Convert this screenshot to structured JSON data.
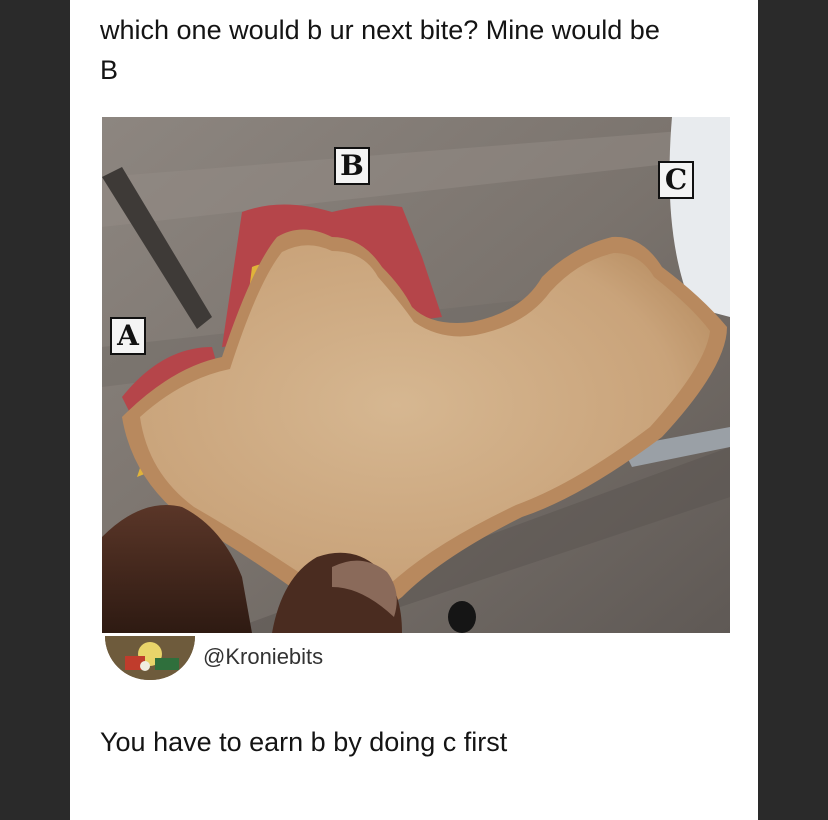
{
  "post": {
    "caption": "which one would b ur next bite? Mine would be B",
    "image_labels": {
      "a": "A",
      "b": "B",
      "c": "C"
    },
    "author_handle": "@Kroniebits",
    "reply_text": "You have to earn b by doing c first"
  },
  "colors": {
    "backdrop": "#2a2a2a",
    "card": "#ffffff",
    "text": "#141414",
    "bread_crust": "#b8895e",
    "bread_crumb": "#d0b08a",
    "ham": "#b5454a"
  }
}
